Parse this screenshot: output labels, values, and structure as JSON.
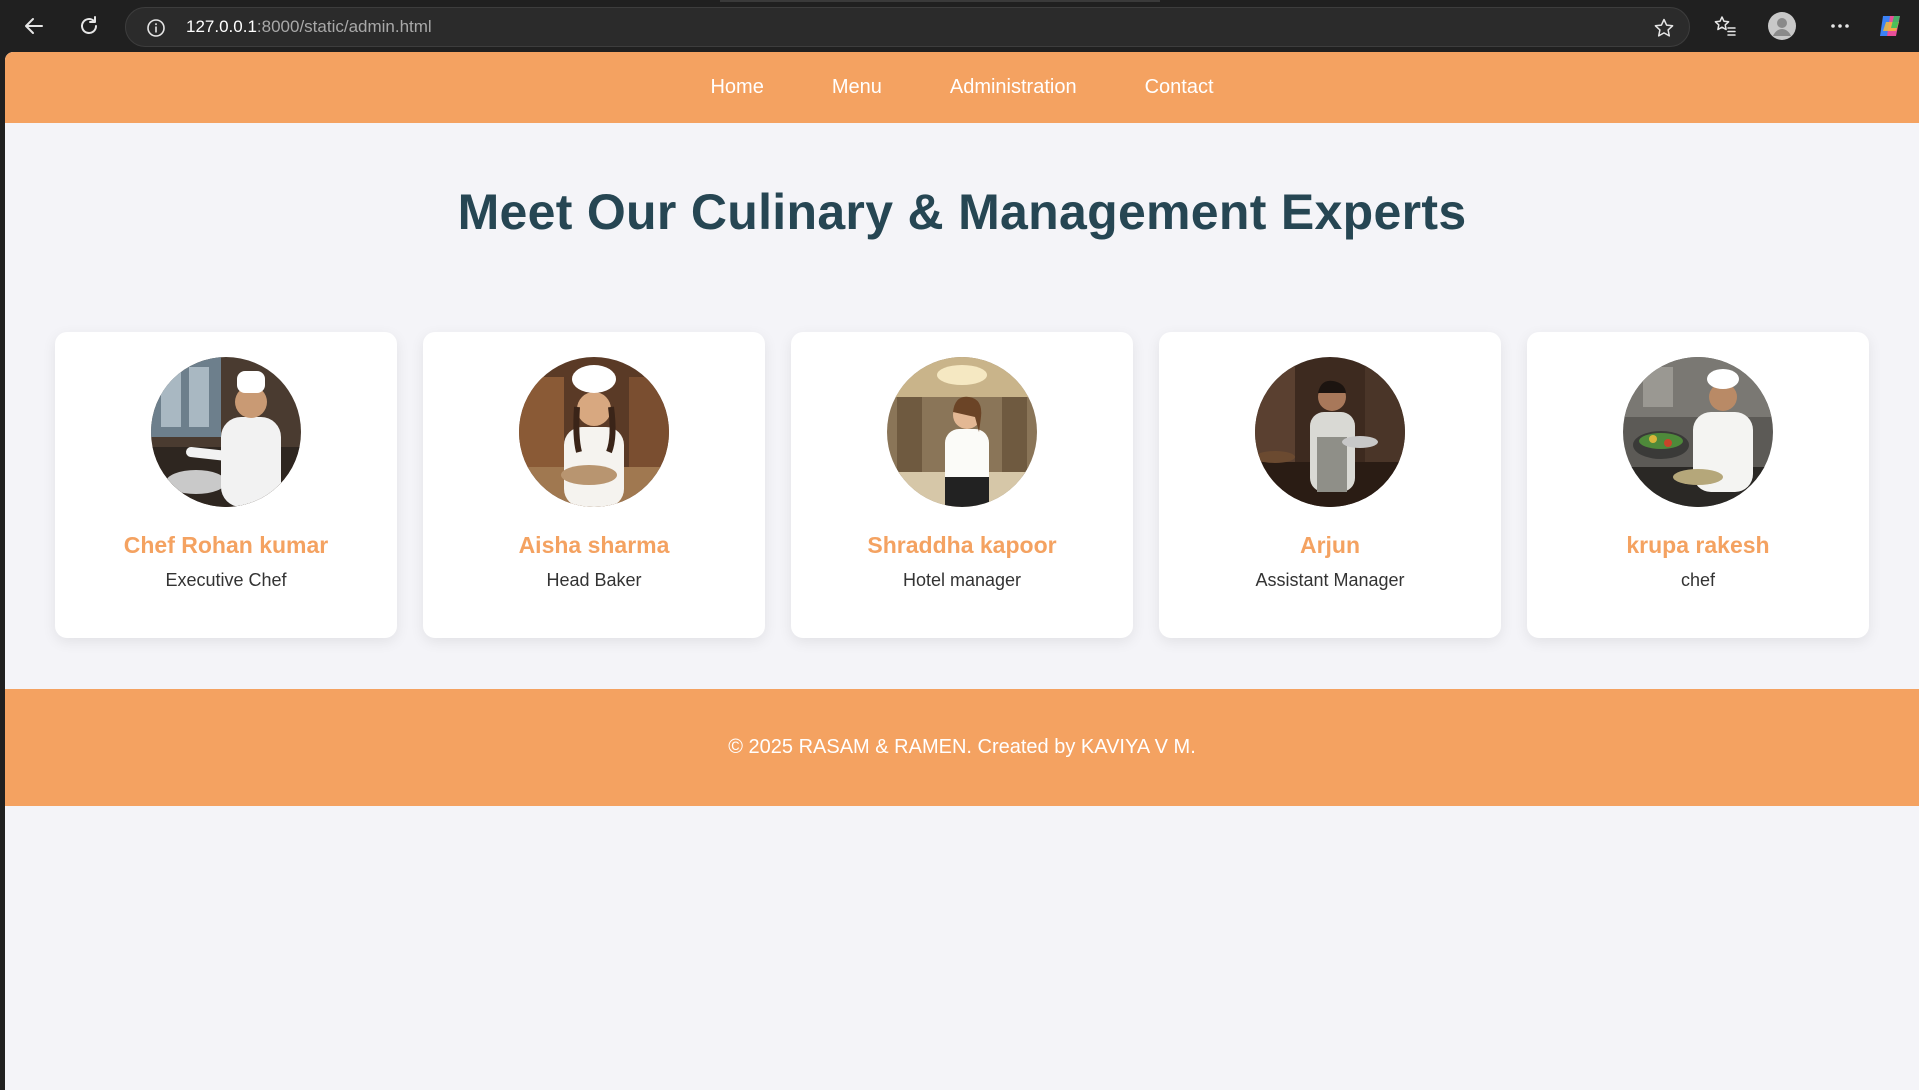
{
  "browser": {
    "url_host": "127.0.0.1",
    "url_path": ":8000/static/admin.html"
  },
  "nav": {
    "items": [
      {
        "label": "Home"
      },
      {
        "label": "Menu"
      },
      {
        "label": "Administration"
      },
      {
        "label": "Contact"
      }
    ]
  },
  "page": {
    "title": "Meet Our Culinary & Management Experts"
  },
  "team": [
    {
      "name": "Chef Rohan kumar",
      "role": "Executive Chef"
    },
    {
      "name": "Aisha sharma",
      "role": "Head Baker"
    },
    {
      "name": "Shraddha kapoor",
      "role": "Hotel manager"
    },
    {
      "name": "Arjun",
      "role": "Assistant Manager"
    },
    {
      "name": "krupa rakesh",
      "role": "chef"
    }
  ],
  "footer": {
    "text": "© 2025 RASAM & RAMEN. Created by KAVIYA V M."
  },
  "colors": {
    "accent": "#f4a261",
    "heading": "#264653",
    "page_bg": "#f4f4f8"
  }
}
